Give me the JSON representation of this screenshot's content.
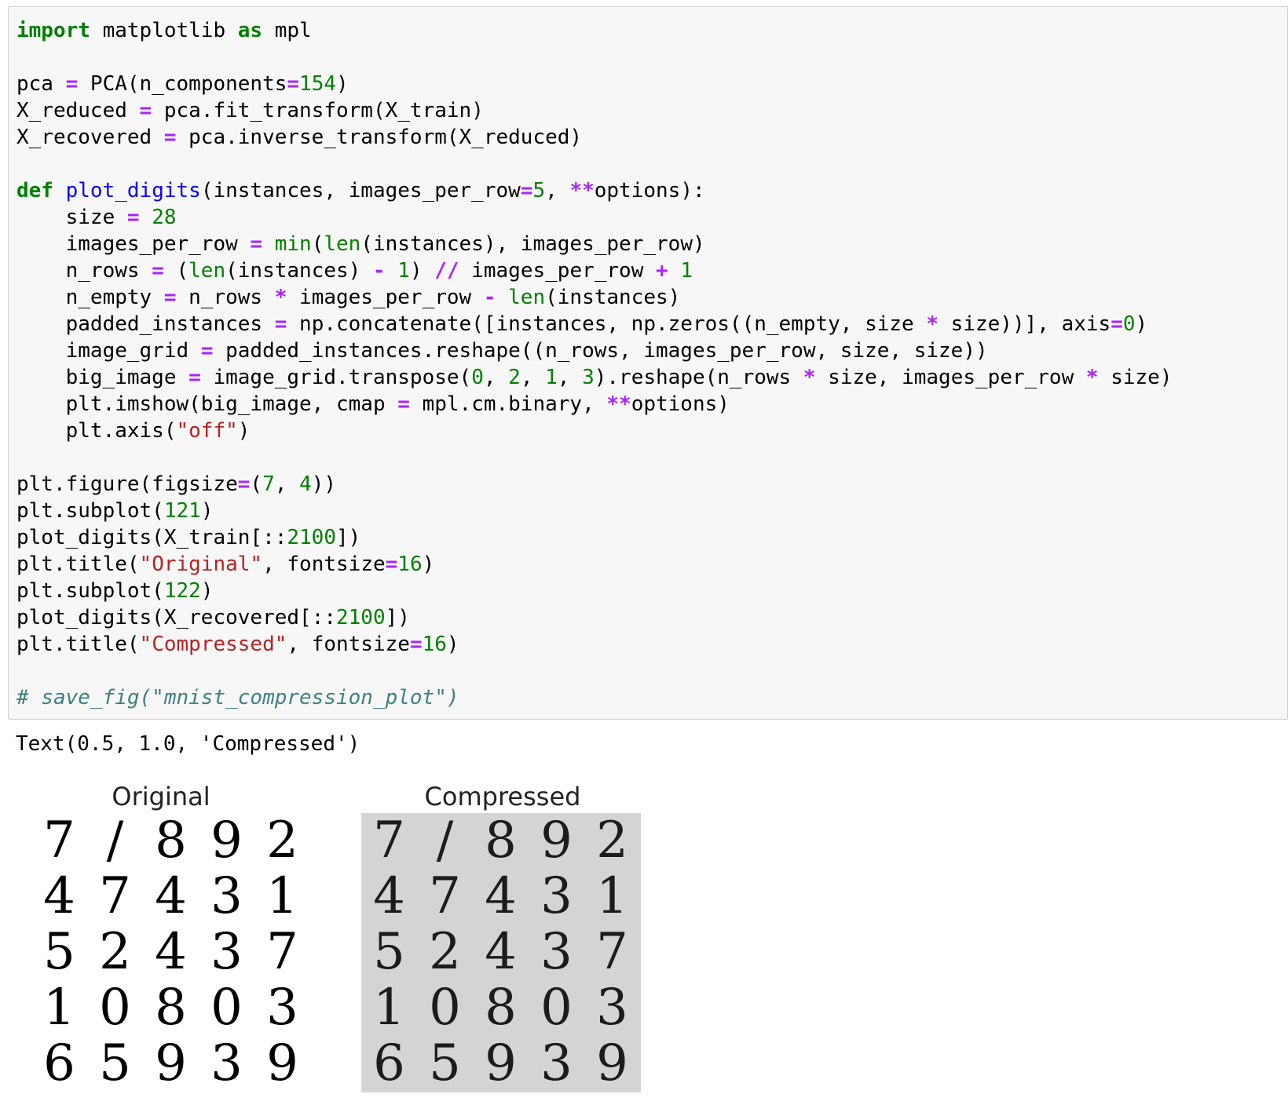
{
  "code_cell": {
    "lines": [
      [
        {
          "t": "import",
          "c": "kw"
        },
        {
          "t": " matplotlib "
        },
        {
          "t": "as",
          "c": "kw"
        },
        {
          "t": " mpl"
        }
      ],
      [],
      [
        {
          "t": "pca "
        },
        {
          "t": "=",
          "c": "op"
        },
        {
          "t": " PCA(n_components"
        },
        {
          "t": "=",
          "c": "op"
        },
        {
          "t": "154",
          "c": "num"
        },
        {
          "t": ")"
        }
      ],
      [
        {
          "t": "X_reduced "
        },
        {
          "t": "=",
          "c": "op"
        },
        {
          "t": " pca.fit_transform(X_train)"
        }
      ],
      [
        {
          "t": "X_recovered "
        },
        {
          "t": "=",
          "c": "op"
        },
        {
          "t": " pca.inverse_transform(X_reduced)"
        }
      ],
      [],
      [
        {
          "t": "def",
          "c": "kw"
        },
        {
          "t": " "
        },
        {
          "t": "plot_digits",
          "c": "fn"
        },
        {
          "t": "(instances, images_per_row"
        },
        {
          "t": "=",
          "c": "op"
        },
        {
          "t": "5",
          "c": "num"
        },
        {
          "t": ", "
        },
        {
          "t": "**",
          "c": "op"
        },
        {
          "t": "options):"
        }
      ],
      [
        {
          "t": "    size "
        },
        {
          "t": "=",
          "c": "op"
        },
        {
          "t": " "
        },
        {
          "t": "28",
          "c": "num"
        }
      ],
      [
        {
          "t": "    images_per_row "
        },
        {
          "t": "=",
          "c": "op"
        },
        {
          "t": " "
        },
        {
          "t": "min",
          "c": "bi"
        },
        {
          "t": "("
        },
        {
          "t": "len",
          "c": "bi"
        },
        {
          "t": "(instances), images_per_row)"
        }
      ],
      [
        {
          "t": "    n_rows "
        },
        {
          "t": "=",
          "c": "op"
        },
        {
          "t": " ("
        },
        {
          "t": "len",
          "c": "bi"
        },
        {
          "t": "(instances) "
        },
        {
          "t": "-",
          "c": "op"
        },
        {
          "t": " "
        },
        {
          "t": "1",
          "c": "num"
        },
        {
          "t": ") "
        },
        {
          "t": "//",
          "c": "op"
        },
        {
          "t": " images_per_row "
        },
        {
          "t": "+",
          "c": "op"
        },
        {
          "t": " "
        },
        {
          "t": "1",
          "c": "num"
        }
      ],
      [
        {
          "t": "    n_empty "
        },
        {
          "t": "=",
          "c": "op"
        },
        {
          "t": " n_rows "
        },
        {
          "t": "*",
          "c": "op"
        },
        {
          "t": " images_per_row "
        },
        {
          "t": "-",
          "c": "op"
        },
        {
          "t": " "
        },
        {
          "t": "len",
          "c": "bi"
        },
        {
          "t": "(instances)"
        }
      ],
      [
        {
          "t": "    padded_instances "
        },
        {
          "t": "=",
          "c": "op"
        },
        {
          "t": " np.concatenate([instances, np.zeros((n_empty, size "
        },
        {
          "t": "*",
          "c": "op"
        },
        {
          "t": " size))], axis"
        },
        {
          "t": "=",
          "c": "op"
        },
        {
          "t": "0",
          "c": "num"
        },
        {
          "t": ")"
        }
      ],
      [
        {
          "t": "    image_grid "
        },
        {
          "t": "=",
          "c": "op"
        },
        {
          "t": " padded_instances.reshape((n_rows, images_per_row, size, size))"
        }
      ],
      [
        {
          "t": "    big_image "
        },
        {
          "t": "=",
          "c": "op"
        },
        {
          "t": " image_grid.transpose("
        },
        {
          "t": "0",
          "c": "num"
        },
        {
          "t": ", "
        },
        {
          "t": "2",
          "c": "num"
        },
        {
          "t": ", "
        },
        {
          "t": "1",
          "c": "num"
        },
        {
          "t": ", "
        },
        {
          "t": "3",
          "c": "num"
        },
        {
          "t": ").reshape(n_rows "
        },
        {
          "t": "*",
          "c": "op"
        },
        {
          "t": " size, images_per_row "
        },
        {
          "t": "*",
          "c": "op"
        },
        {
          "t": " size)"
        }
      ],
      [
        {
          "t": "    plt.imshow(big_image, cmap "
        },
        {
          "t": "=",
          "c": "op"
        },
        {
          "t": " mpl.cm.binary, "
        },
        {
          "t": "**",
          "c": "op"
        },
        {
          "t": "options)"
        }
      ],
      [
        {
          "t": "    plt.axis("
        },
        {
          "t": "\"off\"",
          "c": "str"
        },
        {
          "t": ")"
        }
      ],
      [],
      [
        {
          "t": "plt.figure(figsize"
        },
        {
          "t": "=",
          "c": "op"
        },
        {
          "t": "("
        },
        {
          "t": "7",
          "c": "num"
        },
        {
          "t": ", "
        },
        {
          "t": "4",
          "c": "num"
        },
        {
          "t": "))"
        }
      ],
      [
        {
          "t": "plt.subplot("
        },
        {
          "t": "121",
          "c": "num"
        },
        {
          "t": ")"
        }
      ],
      [
        {
          "t": "plot_digits(X_train[::"
        },
        {
          "t": "2100",
          "c": "num"
        },
        {
          "t": "])"
        }
      ],
      [
        {
          "t": "plt.title("
        },
        {
          "t": "\"Original\"",
          "c": "str"
        },
        {
          "t": ", fontsize"
        },
        {
          "t": "=",
          "c": "op"
        },
        {
          "t": "16",
          "c": "num"
        },
        {
          "t": ")"
        }
      ],
      [
        {
          "t": "plt.subplot("
        },
        {
          "t": "122",
          "c": "num"
        },
        {
          "t": ")"
        }
      ],
      [
        {
          "t": "plot_digits(X_recovered[::"
        },
        {
          "t": "2100",
          "c": "num"
        },
        {
          "t": "])"
        }
      ],
      [
        {
          "t": "plt.title("
        },
        {
          "t": "\"Compressed\"",
          "c": "str"
        },
        {
          "t": ", fontsize"
        },
        {
          "t": "=",
          "c": "op"
        },
        {
          "t": "16",
          "c": "num"
        },
        {
          "t": ")"
        }
      ],
      [],
      [
        {
          "t": "# save_fig(\"mnist_compression_plot\")",
          "c": "cm"
        }
      ]
    ]
  },
  "output": {
    "text": "Text(0.5, 1.0, 'Compressed')"
  },
  "figure": {
    "left_title": "Original",
    "right_title": "Compressed",
    "digit_rows": [
      [
        "7",
        "/",
        "8",
        "9",
        "2"
      ],
      [
        "4",
        "7",
        "4",
        "3",
        "1"
      ],
      [
        "5",
        "2",
        "4",
        "3",
        "7"
      ],
      [
        "1",
        "0",
        "8",
        "0",
        "3"
      ],
      [
        "6",
        "5",
        "9",
        "3",
        "9"
      ]
    ]
  },
  "colors": {
    "keyword": "#008000",
    "operator": "#aa22ff",
    "number": "#008000",
    "string": "#ba2121",
    "function": "#0000ff",
    "comment": "#408080",
    "cell_background": "#f7f7f7",
    "compressed_background": "#d4d4d4"
  }
}
